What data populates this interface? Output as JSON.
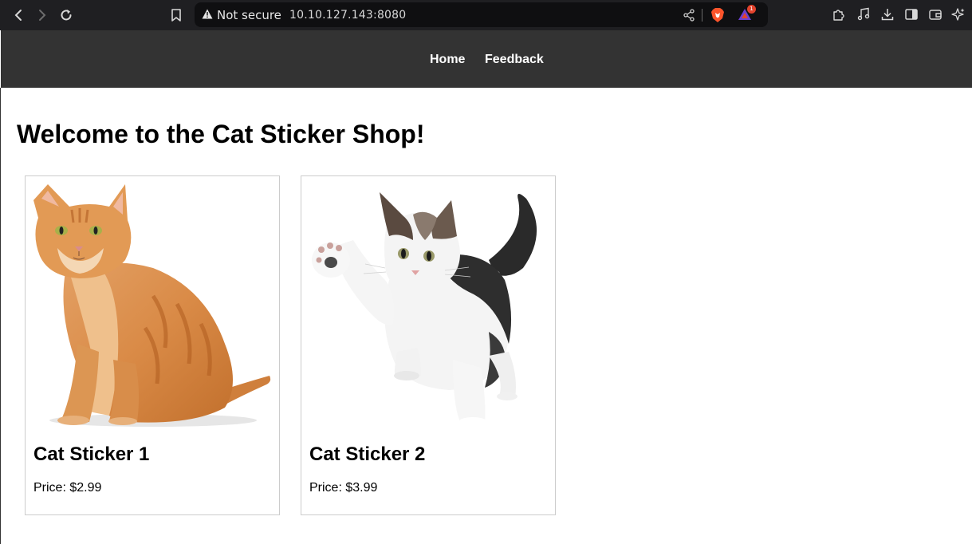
{
  "browser": {
    "security_label": "Not secure",
    "url": "10.10.127.143:8080",
    "rewards_badge": "1",
    "icons": [
      "back-icon",
      "forward-icon",
      "reload-icon",
      "bookmark-icon",
      "warning-icon",
      "share-icon",
      "brave-shield-icon",
      "brave-rewards-icon",
      "extensions-icon",
      "media-icon",
      "downloads-icon",
      "sidebar-icon",
      "wallet-icon",
      "leo-ai-icon"
    ]
  },
  "nav": {
    "home": "Home",
    "feedback": "Feedback"
  },
  "page": {
    "title": "Welcome to the Cat Sticker Shop!"
  },
  "products": [
    {
      "name": "Cat Sticker 1",
      "price": "Price: $2.99",
      "image": "orange-tabby-cat"
    },
    {
      "name": "Cat Sticker 2",
      "price": "Price: $3.99",
      "image": "calico-kitten-waving"
    }
  ],
  "colors": {
    "nav_bg": "#333333",
    "browser_bg": "#1f1f22",
    "card_border": "#cccccc",
    "brave_orange": "#fb542b"
  }
}
